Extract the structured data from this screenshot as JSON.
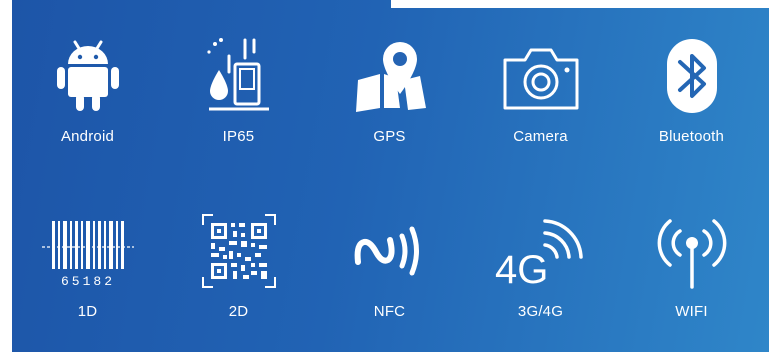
{
  "features": {
    "android": {
      "label": "Android",
      "icon": "android-icon"
    },
    "ip65": {
      "label": "IP65",
      "icon": "water-drop-icon"
    },
    "gps": {
      "label": "GPS",
      "icon": "map-pin-icon"
    },
    "camera": {
      "label": "Camera",
      "icon": "camera-icon"
    },
    "bluetooth": {
      "label": "Bluetooth",
      "icon": "bluetooth-icon"
    },
    "barcode": {
      "label": "1D",
      "icon": "barcode-icon",
      "code_number": "65182"
    },
    "qr": {
      "label": "2D",
      "icon": "qr-code-icon"
    },
    "nfc": {
      "label": "NFC",
      "icon": "nfc-icon"
    },
    "network": {
      "label": "3G/4G",
      "icon": "signal-4g-icon",
      "icon_text": "4G"
    },
    "wifi": {
      "label": "WIFI",
      "icon": "wifi-antenna-icon"
    }
  },
  "colors": {
    "gradient_start": "#1d55a8",
    "gradient_end": "#2f86c9",
    "icon": "#ffffff"
  }
}
